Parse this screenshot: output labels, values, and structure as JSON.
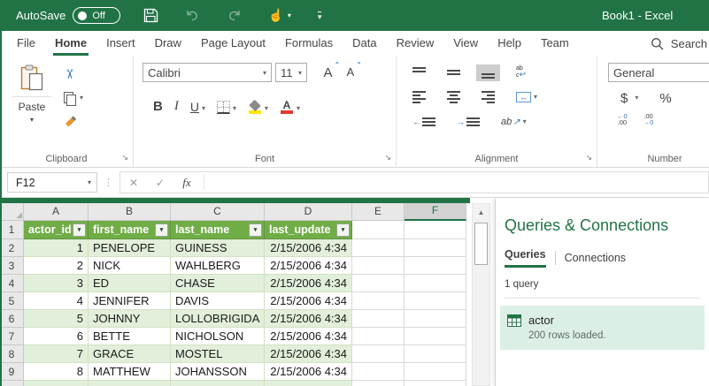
{
  "icons": {
    "caret_down": "▾",
    "scissors": "✂",
    "check": "✓",
    "cancel": "✕",
    "dots": "⋮",
    "corner_triangle": "◢",
    "scroll_up": "▲",
    "launcher": "↘",
    "wrap_return": "↩",
    "merge_arrows": "↔",
    "arrow_left": "←",
    "arrow_right": "→",
    "orient_arrow": "↗",
    "grow_caret": "ˆ",
    "shrink_caret": "ˇ",
    "touch_pointer": "☝",
    "filter_caret": "▾"
  },
  "titlebar": {
    "autosave_label": "AutoSave",
    "autosave_state": "Off",
    "title": "Book1 - Excel"
  },
  "ribbon_tabs": {
    "items": [
      {
        "label": "File",
        "active": false
      },
      {
        "label": "Home",
        "active": true
      },
      {
        "label": "Insert",
        "active": false
      },
      {
        "label": "Draw",
        "active": false
      },
      {
        "label": "Page Layout",
        "active": false
      },
      {
        "label": "Formulas",
        "active": false
      },
      {
        "label": "Data",
        "active": false
      },
      {
        "label": "Review",
        "active": false
      },
      {
        "label": "View",
        "active": false
      },
      {
        "label": "Help",
        "active": false
      },
      {
        "label": "Team",
        "active": false
      }
    ],
    "search_label": "Search"
  },
  "ribbon": {
    "clipboard": {
      "paste_label": "Paste",
      "group_label": "Clipboard"
    },
    "font": {
      "font_name": "Calibri",
      "font_size": "11",
      "bold": "B",
      "italic": "I",
      "underline": "U",
      "grow_letter": "A",
      "shrink_letter": "A",
      "color_letter": "A",
      "group_label": "Font"
    },
    "alignment": {
      "group_label": "Alignment",
      "wrap_ab": "ab",
      "wrap_c": "c",
      "orientation_text": "ab"
    },
    "number": {
      "format": "General",
      "currency": "$",
      "percent": "%",
      "inc_top": "←0",
      "inc_bottom": ".00",
      "dec_top": ".00",
      "dec_bottom": "→0",
      "group_label": "Number"
    }
  },
  "formula_bar": {
    "name_box": "F12",
    "insert_function": "fx"
  },
  "sheet": {
    "column_letters": [
      "A",
      "B",
      "C",
      "D",
      "E",
      "F"
    ],
    "selected_column": "F",
    "header_row_number": "1",
    "headers": [
      "actor_id",
      "first_name",
      "last_name",
      "last_update"
    ],
    "rows": [
      {
        "n": "2",
        "actor_id": "1",
        "first_name": "PENELOPE",
        "last_name": "GUINESS",
        "last_update": "2/15/2006 4:34"
      },
      {
        "n": "3",
        "actor_id": "2",
        "first_name": "NICK",
        "last_name": "WAHLBERG",
        "last_update": "2/15/2006 4:34"
      },
      {
        "n": "4",
        "actor_id": "3",
        "first_name": "ED",
        "last_name": "CHASE",
        "last_update": "2/15/2006 4:34"
      },
      {
        "n": "5",
        "actor_id": "4",
        "first_name": "JENNIFER",
        "last_name": "DAVIS",
        "last_update": "2/15/2006 4:34"
      },
      {
        "n": "6",
        "actor_id": "5",
        "first_name": "JOHNNY",
        "last_name": "LOLLOBRIGIDA",
        "last_update": "2/15/2006 4:34"
      },
      {
        "n": "7",
        "actor_id": "6",
        "first_name": "BETTE",
        "last_name": "NICHOLSON",
        "last_update": "2/15/2006 4:34"
      },
      {
        "n": "8",
        "actor_id": "7",
        "first_name": "GRACE",
        "last_name": "MOSTEL",
        "last_update": "2/15/2006 4:34"
      },
      {
        "n": "9",
        "actor_id": "8",
        "first_name": "MATTHEW",
        "last_name": "JOHANSSON",
        "last_update": "2/15/2006 4:34"
      }
    ]
  },
  "panel": {
    "title": "Queries & Connections",
    "tabs": [
      {
        "label": "Queries",
        "active": true
      },
      {
        "label": "Connections",
        "active": false
      }
    ],
    "count_label": "1 query",
    "query": {
      "name": "actor",
      "status": "200 rows loaded."
    }
  },
  "colors": {
    "excel_green": "#217346",
    "table_header_green": "#70AD47",
    "band_green": "#E2EFDA",
    "query_highlight": "#DCEFE5"
  }
}
